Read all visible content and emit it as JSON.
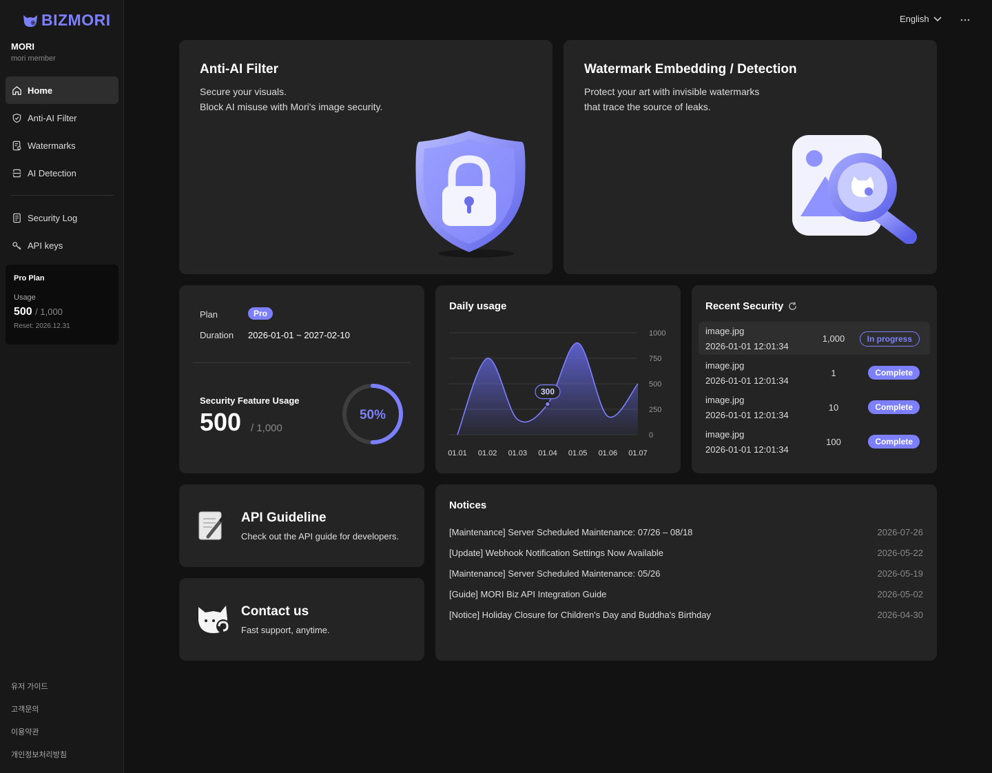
{
  "brand": {
    "name": "BIZMORI",
    "accent": "#7C80FF"
  },
  "user": {
    "name": "MORI",
    "role": "mori member"
  },
  "nav": {
    "items": [
      {
        "label": "Home",
        "icon": "home-icon"
      },
      {
        "label": "Anti-AI Filter",
        "icon": "shield-icon"
      },
      {
        "label": "Watermarks",
        "icon": "watermark-icon"
      },
      {
        "label": "AI Detection",
        "icon": "scan-icon"
      }
    ],
    "secondary": [
      {
        "label": "Security Log",
        "icon": "log-icon"
      },
      {
        "label": "API keys",
        "icon": "key-icon"
      }
    ]
  },
  "plan_box": {
    "title": "Pro Plan",
    "usage_label": "Usage",
    "usage_value": "500",
    "usage_max": "/ 1,000",
    "reset": "Reset: 2026.12.31"
  },
  "footer_links": [
    "유저 가이드",
    "고객문의",
    "이용약관",
    "개인정보처리방침"
  ],
  "header": {
    "language": "English"
  },
  "anti_ai": {
    "title": "Anti-AI Filter",
    "line1": "Secure your visuals.",
    "line2": "Block AI misuse with Mori's image security."
  },
  "watermark": {
    "title": "Watermark Embedding / Detection",
    "line1": "Protect your art with invisible watermarks",
    "line2": "that trace the source of leaks."
  },
  "plan_card": {
    "plan_label": "Plan",
    "plan_badge": "Pro",
    "duration_label": "Duration",
    "duration_value": "2026-01-01 ~ 2027-02-10",
    "usage_title": "Security Feature Usage",
    "usage_value": "500",
    "usage_max": "/ 1,000",
    "percent_label": "50%",
    "percent": 0.5
  },
  "daily_usage": {
    "title": "Daily usage",
    "tooltip": "300",
    "chart_data": {
      "type": "area",
      "categories": [
        "01.01",
        "01.02",
        "01.03",
        "01.04",
        "01.05",
        "01.06",
        "01.07"
      ],
      "series": [
        {
          "values": [
            0,
            750,
            150,
            300,
            900,
            180,
            500
          ]
        }
      ],
      "yticks": [
        1000,
        750,
        500,
        250,
        0
      ],
      "ylim": [
        0,
        1000
      ],
      "highlight_index": 3
    }
  },
  "recent_security": {
    "title": "Recent Security",
    "rows": [
      {
        "file": "image.jpg",
        "time": "2026-01-01 12:01:34",
        "count": "1,000",
        "status": "In progress"
      },
      {
        "file": "image.jpg",
        "time": "2026-01-01 12:01:34",
        "count": "1",
        "status": "Complete"
      },
      {
        "file": "image.jpg",
        "time": "2026-01-01 12:01:34",
        "count": "10",
        "status": "Complete"
      },
      {
        "file": "image.jpg",
        "time": "2026-01-01 12:01:34",
        "count": "100",
        "status": "Complete"
      }
    ]
  },
  "api_guideline": {
    "title": "API Guideline",
    "desc": "Check out the API guide for developers."
  },
  "contact": {
    "title": "Contact us",
    "desc": "Fast support, anytime."
  },
  "notices": {
    "title": "Notices",
    "items": [
      {
        "title": "[Maintenance] Server Scheduled Maintenance: 07/26 – 08/18",
        "date": "2026-07-26"
      },
      {
        "title": "[Update] Webhook Notification Settings Now Available",
        "date": "2026-05-22"
      },
      {
        "title": "[Maintenance] Server Scheduled Maintenance: 05/26",
        "date": "2026-05-19"
      },
      {
        "title": "[Guide] MORI Biz API Integration Guide",
        "date": "2026-05-02"
      },
      {
        "title": "[Notice] Holiday Closure for Children's Day and Buddha's Birthday",
        "date": "2026-04-30"
      }
    ]
  }
}
